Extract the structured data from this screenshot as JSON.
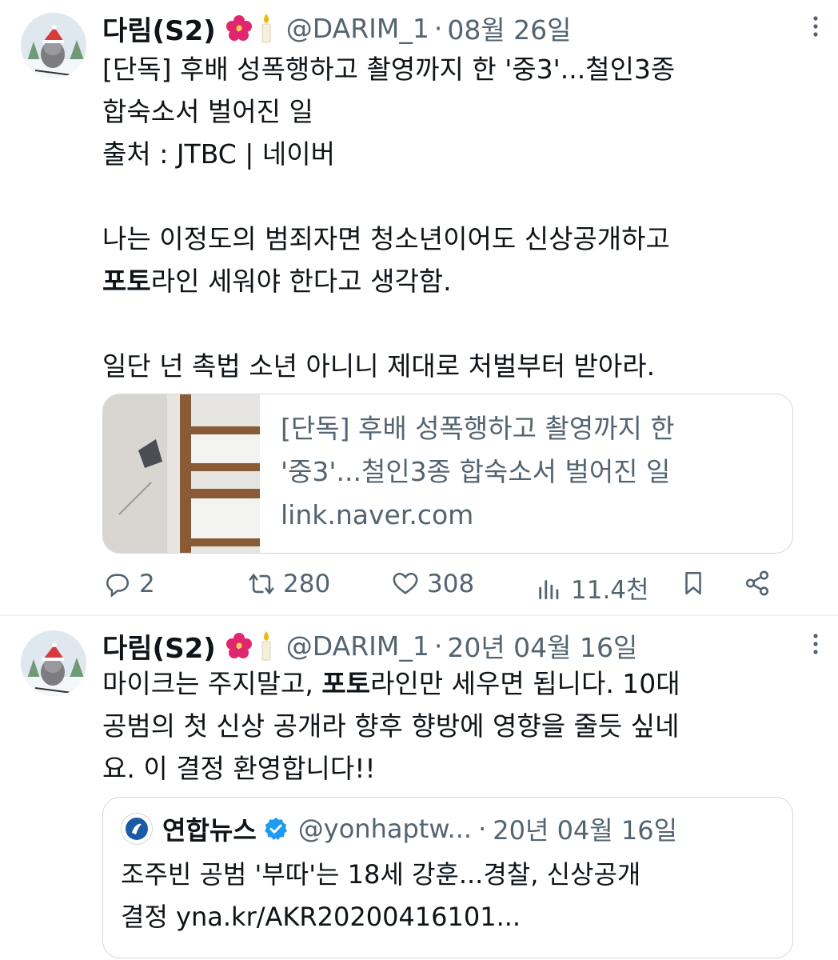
{
  "tweets": [
    {
      "author_name": "다림(S2)",
      "emoji": "🌺🕯️",
      "handle": "@DARIM_1",
      "separator": "·",
      "date": "08월 26일",
      "more_label": "⋮",
      "lines": [
        "[단독] 후배 성폭행하고 촬영까지 한 '중3'...철인3종",
        "합숙소서 벌어진 일",
        "출처 : JTBC | 네이버",
        "",
        "나는 이정도의 범죄자면 청소년이어도 신상공개하고",
        "라인 세워야 한다고 생각함.",
        "",
        "일단 넌 촉법 소년 아니니 제대로 처벌부터 받아라."
      ],
      "bold_word": "포토",
      "card": {
        "title_line1": "[단독] 후배 성폭행하고 촬영까지 한",
        "title_line2": "'중3'...철인3종 합숙소서 벌어진 일",
        "domain": "link.naver.com"
      },
      "actions": {
        "replies": "2",
        "retweets": "280",
        "likes": "308",
        "views": "11.4천"
      }
    },
    {
      "author_name": "다림(S2)",
      "emoji": "🌺🕯️",
      "handle": "@DARIM_1",
      "separator": "·",
      "date": "20년 04월 16일",
      "more_label": "⋮",
      "line1_before": "마이크는 주지말고, ",
      "bold_word": "포토",
      "line1_after": "라인만 세우면 됩니다. 10대",
      "line2": "공범의 첫 신상 공개라 향후 향방에 영향을 줄듯 싶네",
      "line3": "요. 이 결정 환영합니다!!",
      "quote": {
        "name": "연합뉴스",
        "handle": "@yonhaptw...",
        "separator": "·",
        "date": "20년 04월 16일",
        "line1": "조주빈 공범 '부따'는 18세 강훈...경찰, 신상공개",
        "line2": "결정 yna.kr/AKR20200416101..."
      }
    }
  ],
  "colors": {
    "text": "#0f1419",
    "secondary": "#536471",
    "border": "#cfd9de",
    "verified": "#1d9bf0"
  }
}
